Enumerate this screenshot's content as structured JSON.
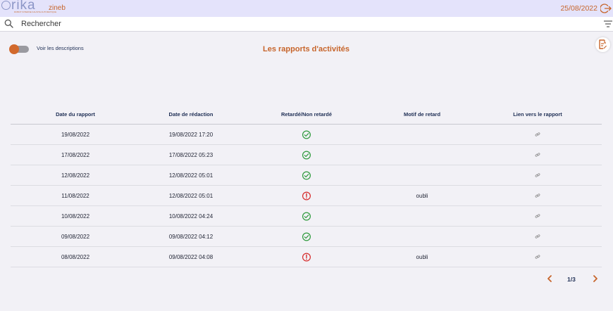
{
  "header": {
    "logo_text": "rika",
    "logo_subtitle": "ROBOT INTERNE KALISTE AUTOMATIQUE",
    "username": "zineb",
    "date": "25/08/2022"
  },
  "search": {
    "placeholder": "Rechercher"
  },
  "toolbar": {
    "toggle_label": "Voir les descriptions",
    "toggle_on": false,
    "title": "Les rapports d'activités"
  },
  "table": {
    "columns": [
      "Date du rapport",
      "Date de rédaction",
      "Retardé/Non retardé",
      "Motif de retard",
      "Lien vers le rapport"
    ],
    "rows": [
      {
        "report_date": "19/08/2022",
        "written_date": "19/08/2022 17:20",
        "late": false,
        "reason": ""
      },
      {
        "report_date": "17/08/2022",
        "written_date": "17/08/2022 05:23",
        "late": false,
        "reason": ""
      },
      {
        "report_date": "12/08/2022",
        "written_date": "12/08/2022 05:01",
        "late": false,
        "reason": ""
      },
      {
        "report_date": "11/08/2022",
        "written_date": "12/08/2022 05:01",
        "late": true,
        "reason": "oubli"
      },
      {
        "report_date": "10/08/2022",
        "written_date": "10/08/2022 04:24",
        "late": false,
        "reason": ""
      },
      {
        "report_date": "09/08/2022",
        "written_date": "09/08/2022 04:12",
        "late": false,
        "reason": ""
      },
      {
        "report_date": "08/08/2022",
        "written_date": "09/08/2022 04:08",
        "late": true,
        "reason": "oubli"
      }
    ]
  },
  "pagination": {
    "indicator": "1/3"
  },
  "colors": {
    "accent": "#c7652b",
    "on_time": "#2e9a3c",
    "late": "#d62c2c",
    "header_bg": "#e4e3fb"
  }
}
